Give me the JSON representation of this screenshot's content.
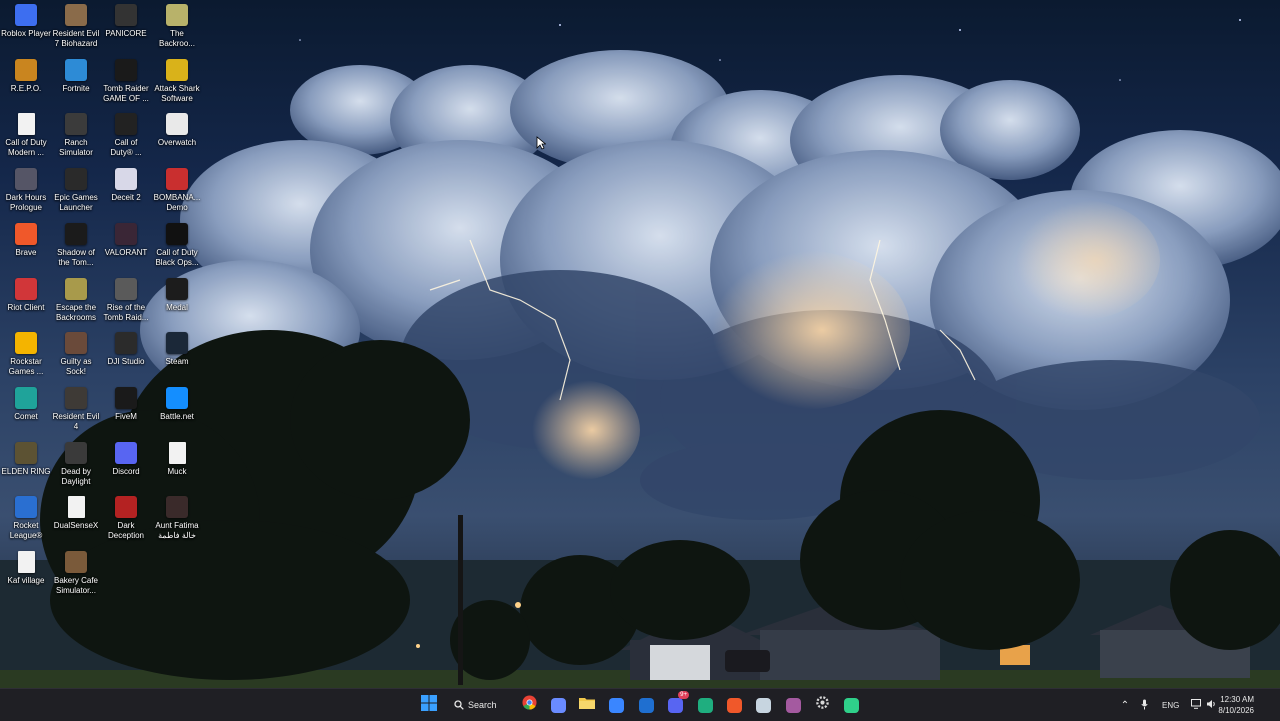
{
  "desktop": {
    "icons": [
      {
        "label": "Roblox Player",
        "icon": "roblox-icon",
        "color": "#3d6ef0"
      },
      {
        "label": "Resident Evil\n7 Biohazard",
        "icon": "re7-icon",
        "color": "#8a6b4a"
      },
      {
        "label": "PANICORE",
        "icon": "panicore-icon",
        "color": "#333333"
      },
      {
        "label": "The\nBackroo...",
        "icon": "backrooms-icon",
        "color": "#b8b26a"
      },
      {
        "label": "R.E.P.O.",
        "icon": "repo-icon",
        "color": "#c9851f"
      },
      {
        "label": "Fortnite",
        "icon": "fortnite-icon",
        "color": "#2d8bd6"
      },
      {
        "label": "Tomb Raider\nGAME OF ...",
        "icon": "tomb-raider-icon",
        "color": "#1a1a1a"
      },
      {
        "label": "Attack Shark\nSoftware",
        "icon": "attack-shark-icon",
        "color": "#d9b21a"
      },
      {
        "label": "Call of Duty\nModern ...",
        "icon": "file-icon",
        "color": "#f2f2f2"
      },
      {
        "label": "Ranch\nSimulator",
        "icon": "ranch-sim-icon",
        "color": "#3b3b3b"
      },
      {
        "label": "Call of\nDuty® ...",
        "icon": "cod-icon",
        "color": "#222222"
      },
      {
        "label": "Overwatch",
        "icon": "overwatch-icon",
        "color": "#e9e9e9"
      },
      {
        "label": "Dark Hours\nPrologue",
        "icon": "dark-hours-icon",
        "color": "#555566"
      },
      {
        "label": "Epic Games\nLauncher",
        "icon": "epic-games-icon",
        "color": "#2a2a2a"
      },
      {
        "label": "Deceit 2",
        "icon": "deceit-icon",
        "color": "#d8d8e8"
      },
      {
        "label": "BOMBANA...\nDemo",
        "icon": "bombana-icon",
        "color": "#c92f2f"
      },
      {
        "label": "Brave",
        "icon": "brave-icon",
        "color": "#f0582a"
      },
      {
        "label": "Shadow of\nthe Tom...",
        "icon": "shadow-tomb-icon",
        "color": "#1b1b1b"
      },
      {
        "label": "VALORANT",
        "icon": "valorant-icon",
        "color": "#3a2636"
      },
      {
        "label": "Call of Duty\nBlack Ops...",
        "icon": "cod-bo-icon",
        "color": "#111111"
      },
      {
        "label": "Riot Client",
        "icon": "riot-icon",
        "color": "#d13639"
      },
      {
        "label": "Escape the\nBackrooms",
        "icon": "escape-backrooms-icon",
        "color": "#a89a4b"
      },
      {
        "label": "Rise of the\nTomb Raid...",
        "icon": "rise-tomb-icon",
        "color": "#5a5a5a"
      },
      {
        "label": "Medal",
        "icon": "medal-icon",
        "color": "#1c1c1c"
      },
      {
        "label": "Rockstar\nGames ...",
        "icon": "rockstar-icon",
        "color": "#f4b400"
      },
      {
        "label": "Guilty as\nSock!",
        "icon": "guilty-sock-icon",
        "color": "#6a4a3a"
      },
      {
        "label": "DJI Studio",
        "icon": "dji-icon",
        "color": "#2b2b2b"
      },
      {
        "label": "Steam",
        "icon": "steam-icon",
        "color": "#1b2838"
      },
      {
        "label": "Comet",
        "icon": "comet-icon",
        "color": "#1fa39a"
      },
      {
        "label": "Resident Evil\n4",
        "icon": "re4-icon",
        "color": "#3e3a36"
      },
      {
        "label": "FiveM",
        "icon": "fivem-icon",
        "color": "#1a1a1a"
      },
      {
        "label": "Battle.net",
        "icon": "battlenet-icon",
        "color": "#148eff"
      },
      {
        "label": "ELDEN RING",
        "icon": "elden-ring-icon",
        "color": "#5c5233"
      },
      {
        "label": "Dead by\nDaylight",
        "icon": "dbd-icon",
        "color": "#3a3a3a"
      },
      {
        "label": "Discord",
        "icon": "discord-icon",
        "color": "#5865f2"
      },
      {
        "label": "Muck",
        "icon": "file-icon",
        "color": "#f2f2f2"
      },
      {
        "label": "Rocket\nLeague®",
        "icon": "rocket-league-icon",
        "color": "#2a6fd1"
      },
      {
        "label": "DualSenseX",
        "icon": "file-icon",
        "color": "#f2f2f2"
      },
      {
        "label": "Dark\nDeception",
        "icon": "dark-deception-icon",
        "color": "#b42222"
      },
      {
        "label": "Aunt Fatima\nخالة فاطمة",
        "icon": "aunt-fatima-icon",
        "color": "#3a2a2a"
      },
      {
        "label": "Kaf village",
        "icon": "file-icon",
        "color": "#f2f2f2"
      },
      {
        "label": "Bakery Cafe\nSimulator...",
        "icon": "bakery-icon",
        "color": "#7a5a3a"
      }
    ]
  },
  "taskbar": {
    "search_label": "Search",
    "apps": [
      {
        "icon": "windows-start-icon",
        "color": "#3aa0ff"
      },
      {
        "icon": "chrome-icon",
        "color": "#e94235"
      },
      {
        "icon": "copilot-icon",
        "color": "#6a8bff"
      },
      {
        "icon": "file-explorer-icon",
        "color": "#f2c94c"
      },
      {
        "icon": "microsoft-store-icon",
        "color": "#3a86ff"
      },
      {
        "icon": "outlook-icon",
        "color": "#1f6fd0"
      },
      {
        "icon": "discord-icon",
        "color": "#5865f2"
      },
      {
        "icon": "edge-icon",
        "color": "#1fae7f"
      },
      {
        "icon": "brave-icon",
        "color": "#f0582a"
      },
      {
        "icon": "steam-icon",
        "color": "#c7d5e0"
      },
      {
        "icon": "valorant-icon",
        "color": "#a45aa0"
      },
      {
        "icon": "settings-icon",
        "color": "#d8d8d8"
      },
      {
        "icon": "app-icon",
        "color": "#2fd08a"
      }
    ],
    "discord_badge": "9+",
    "tray": {
      "language": "ENG"
    },
    "clock": {
      "time": "12:30 AM",
      "date": "8/10/2026"
    }
  }
}
